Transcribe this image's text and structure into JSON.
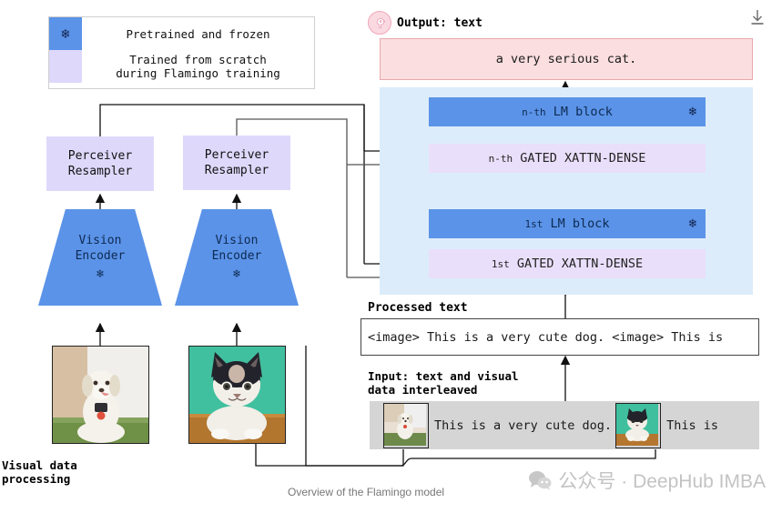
{
  "legend": {
    "frozen_label": "Pretrained and frozen",
    "trained_label_line1": "Trained from scratch",
    "trained_label_line2": "during Flamingo training",
    "frozen_color": "#5b93e8",
    "trained_color": "#ded9fb",
    "snowflake_icon": "❄"
  },
  "output": {
    "header_label": "Output: text",
    "flamingo_icon": "flamingo-logo",
    "text": "a very serious cat.",
    "box_fill": "#fbdedf",
    "box_border": "#e8a9ad"
  },
  "toolbar": {
    "download_icon": "download-icon"
  },
  "lm_panel": {
    "background": "#dcecfa",
    "blocks": [
      {
        "prefix": "n-th",
        "label": "LM block",
        "type": "lm",
        "frozen": true,
        "color": "#5b93e8"
      },
      {
        "prefix": "n-th",
        "label": "GATED XATTN-DENSE",
        "type": "xattn",
        "frozen": false,
        "color": "#eadffb"
      },
      {
        "prefix": "1st",
        "label": "LM block",
        "type": "lm",
        "frozen": true,
        "color": "#5b93e8"
      },
      {
        "prefix": "1st",
        "label": "GATED XATTN-DENSE",
        "type": "xattn",
        "frozen": false,
        "color": "#eadffb"
      }
    ],
    "snowflake_icon": "❄"
  },
  "processed": {
    "label": "Processed text",
    "text": "<image> This is a very cute dog. <image> This is"
  },
  "input": {
    "label_line1": "Input: text and visual",
    "label_line2": "data interleaved",
    "strip_color": "#d5d5d5",
    "items": [
      {
        "kind": "image",
        "alt": "dog-thumbnail"
      },
      {
        "kind": "text",
        "text": "This is a very cute dog."
      },
      {
        "kind": "image",
        "alt": "cat-thumbnail"
      },
      {
        "kind": "text",
        "text": "This is"
      }
    ]
  },
  "vision": {
    "perceiver_line1": "Perceiver",
    "perceiver_line2": "Resampler",
    "encoder_line1": "Vision",
    "encoder_line2": "Encoder",
    "snowflake_icon": "❄",
    "perceiver_color": "#ded9fb",
    "encoder_color": "#5b93e8",
    "visual_label_line1": "Visual data",
    "visual_label_line2": "processing",
    "photos": [
      {
        "alt": "dog-photo"
      },
      {
        "alt": "cat-photo"
      }
    ]
  },
  "footer": {
    "caption": "Overview of the Flamingo model",
    "watermark": "公众号 · DeepHub IMBA",
    "watermark_icon": "wechat-icon"
  }
}
